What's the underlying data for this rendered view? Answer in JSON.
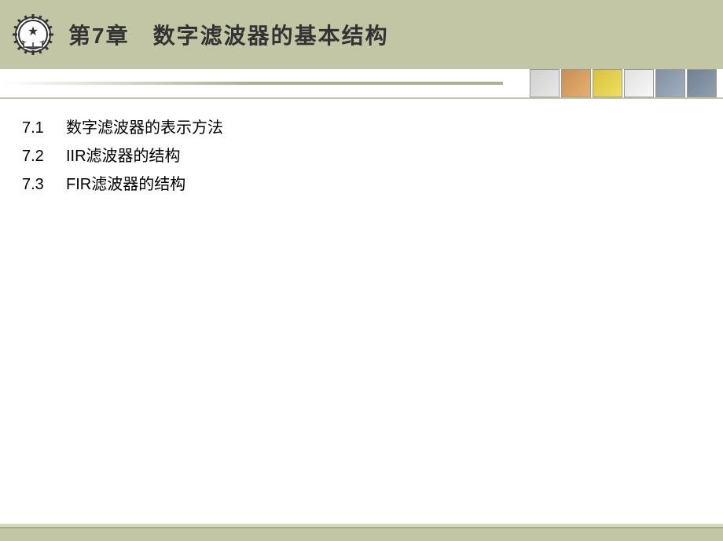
{
  "header": {
    "title": "第7章　数字滤波器的基本结构"
  },
  "toc": [
    {
      "number": "7.1",
      "text": "数字滤波器的表示方法"
    },
    {
      "number": "7.2",
      "text": "IIR滤波器的结构"
    },
    {
      "number": "7.3",
      "text": "FIR滤波器的结构"
    }
  ]
}
